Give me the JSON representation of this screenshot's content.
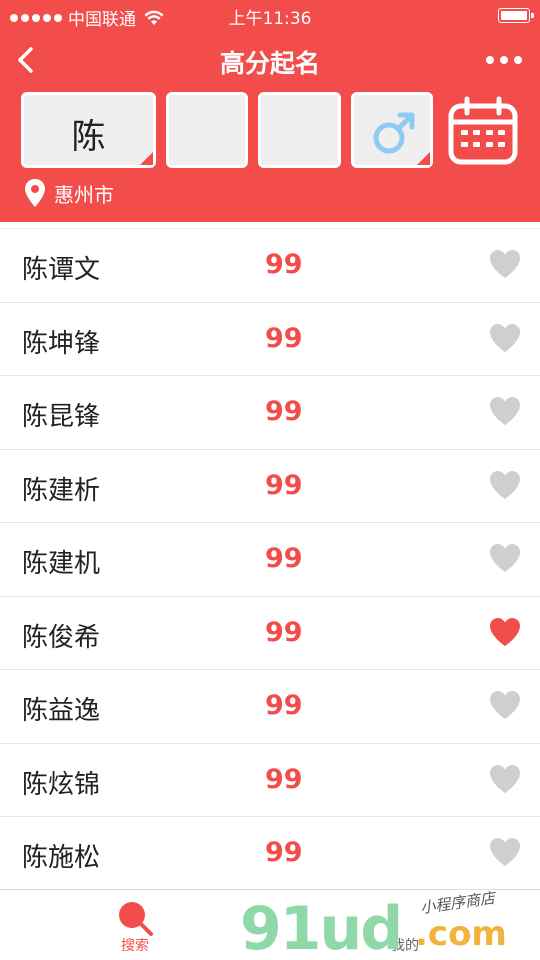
{
  "status_bar": {
    "carrier": "中国联通",
    "time": "上午11:36"
  },
  "nav": {
    "title": "高分起名"
  },
  "inputs": {
    "surname": "陈",
    "given1": "",
    "given2": "",
    "gender": "male"
  },
  "location": {
    "city": "惠州市"
  },
  "names": [
    {
      "name": "陈谭文",
      "score": "99",
      "liked": false
    },
    {
      "name": "陈坤锋",
      "score": "99",
      "liked": false
    },
    {
      "name": "陈昆锋",
      "score": "99",
      "liked": false
    },
    {
      "name": "陈建析",
      "score": "99",
      "liked": false
    },
    {
      "name": "陈建机",
      "score": "99",
      "liked": false
    },
    {
      "name": "陈俊希",
      "score": "99",
      "liked": true
    },
    {
      "name": "陈益逸",
      "score": "99",
      "liked": false
    },
    {
      "name": "陈炫锦",
      "score": "99",
      "liked": false
    },
    {
      "name": "陈施松",
      "score": "99",
      "liked": false
    }
  ],
  "tabbar": {
    "search_label": "搜索",
    "mine_label": "我的"
  },
  "watermark": {
    "brand": "91ud",
    "suffix": ".com",
    "tagline": "小程序商店"
  },
  "colors": {
    "accent": "#f24d4b",
    "heart_off": "#cfcfcf",
    "heart_on": "#f24d4b",
    "gender_male": "#8ecbf0"
  }
}
